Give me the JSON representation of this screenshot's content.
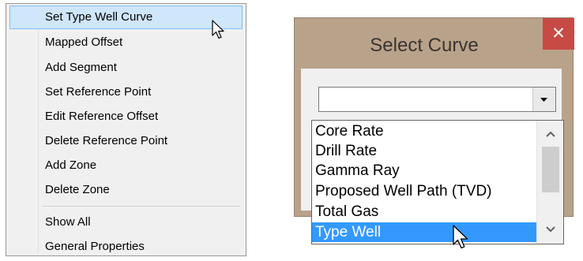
{
  "context_menu": {
    "items": [
      {
        "label": "Set Type Well Curve",
        "highlighted": true
      },
      {
        "label": "Mapped Offset"
      },
      {
        "label": "Add Segment"
      },
      {
        "label": "Set Reference Point"
      },
      {
        "label": "Edit Reference Offset"
      },
      {
        "label": "Delete Reference Point"
      },
      {
        "label": "Add Zone"
      },
      {
        "label": "Delete Zone"
      },
      {
        "label": "Show All"
      },
      {
        "label": "General Properties"
      }
    ]
  },
  "dialog": {
    "title": "Select Curve",
    "close_glyph": "✕",
    "combo_value": "",
    "options": [
      "Core Rate",
      "Drill Rate",
      "Gamma Ray",
      "Proposed Well Path (TVD)",
      "Total Gas",
      "Type Well"
    ],
    "selected_option": "Type Well"
  },
  "colors": {
    "menu_highlight": "#cfe6fb",
    "dialog_frame": "#b9a28a",
    "close_button": "#c84a44",
    "list_selection": "#3399ff"
  }
}
